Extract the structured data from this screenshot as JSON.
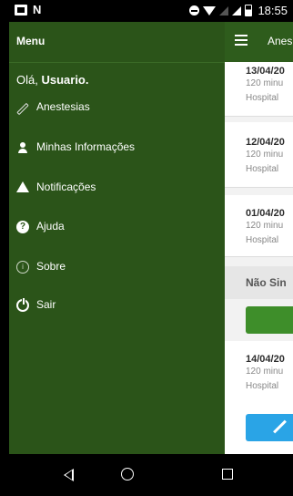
{
  "status_bar": {
    "time": "18:55",
    "notif_letter": "N"
  },
  "app": {
    "title": "Anes"
  },
  "drawer": {
    "header": "Menu",
    "greeting_prefix": "Olá, ",
    "greeting_user": "Usuario.",
    "items": [
      {
        "label": "Anestesias",
        "icon": "syringe-icon"
      },
      {
        "label": "Minhas Informações",
        "icon": "user-icon"
      },
      {
        "label": "Notificações",
        "icon": "warning-icon"
      },
      {
        "label": "Ajuda",
        "icon": "help-icon"
      },
      {
        "label": "Sobre",
        "icon": "info-icon"
      },
      {
        "label": "Sair",
        "icon": "power-icon"
      }
    ]
  },
  "list": {
    "cards": [
      {
        "date": "13/04/20",
        "duration": "120 minu",
        "hospital": "Hospital"
      },
      {
        "date": "12/04/20",
        "duration": "120 minu",
        "hospital": "Hospital"
      },
      {
        "date": "01/04/20",
        "duration": "120 minu",
        "hospital": "Hospital"
      },
      {
        "date": "14/04/20",
        "duration": "120 minu",
        "hospital": "Hospital"
      }
    ],
    "section_label": "Não Sin"
  },
  "colors": {
    "primary": "#2b5419",
    "action_green": "#3e8e2a",
    "action_blue": "#2aa4e6"
  }
}
